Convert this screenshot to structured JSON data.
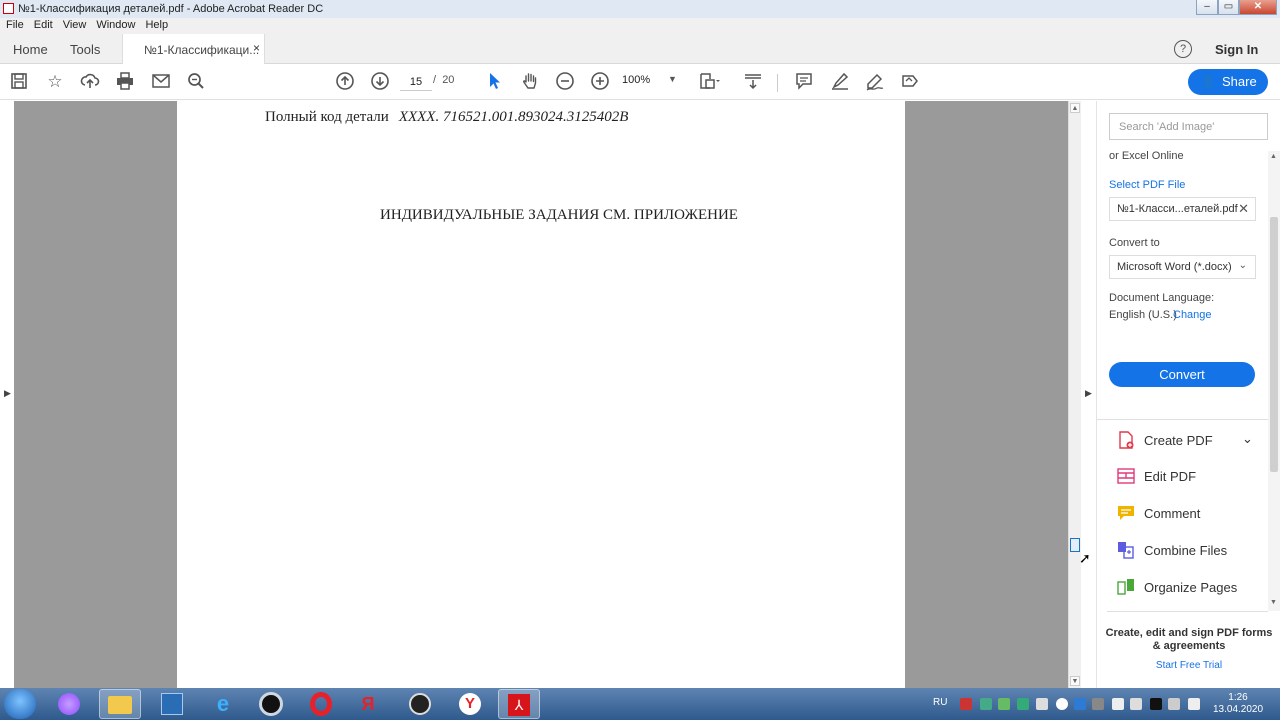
{
  "window": {
    "title": "№1-Классификация деталей.pdf - Adobe Acrobat Reader DC",
    "buttons": {
      "minimize": "–",
      "maximize": "▭",
      "close": "✕"
    }
  },
  "menu": [
    "File",
    "Edit",
    "View",
    "Window",
    "Help"
  ],
  "tabs": {
    "home": "Home",
    "tools": "Tools",
    "document": "№1-Классификаци...",
    "close": "×",
    "help": "?",
    "sign_in": "Sign In"
  },
  "toolbar": {
    "page_current": "15",
    "page_separator": "/",
    "page_total": "20",
    "zoom": "100%",
    "share_label": "Share",
    "icons": [
      "save-icon",
      "bookmark-icon",
      "upload-icon",
      "print-icon",
      "email-icon",
      "search-icon",
      "page-up-icon",
      "page-down-icon",
      "zoom-out-icon",
      "zoom-in-icon",
      "select-icon",
      "hand-icon",
      "fit-page-icon",
      "scroll-mode-icon",
      "comment-icon",
      "highlight-icon",
      "sign-icon",
      "fill-icon"
    ]
  },
  "document": {
    "code_label": "Полный код детали",
    "code_value": "XXXX. 716521.001.893024.3125402B",
    "heading": "ИНДИВИДУАЛЬНЫЕ ЗАДАНИЯ СМ. ПРИЛОЖЕНИЕ"
  },
  "right_pane": {
    "search_placeholder": "Search 'Add Image'",
    "excel_online": "or Excel Online",
    "select_pdf_label": "Select PDF File",
    "selected_file": "№1-Класси...еталей.pdf",
    "convert_to_label": "Convert to",
    "convert_to_value": "Microsoft Word (*.docx)",
    "doc_language_label": "Document Language:",
    "doc_language_value": "English (U.S.)",
    "change_link": "Change",
    "convert_button": "Convert",
    "tools": [
      {
        "label": "Create PDF",
        "icon": "create-pdf-icon",
        "color": "#e0394a"
      },
      {
        "label": "Edit PDF",
        "icon": "edit-pdf-icon",
        "color": "#e0397a"
      },
      {
        "label": "Comment",
        "icon": "comment-icon",
        "color": "#f0b400"
      },
      {
        "label": "Combine Files",
        "icon": "combine-files-icon",
        "color": "#5c5ce0"
      },
      {
        "label": "Organize Pages",
        "icon": "organize-pages-icon",
        "color": "#4aa83a"
      }
    ],
    "promo": "Create, edit and sign PDF forms & agreements",
    "trial_link": "Start Free Trial"
  },
  "taskbar": {
    "apps": [
      "start",
      "alice",
      "explorer",
      "files",
      "ie",
      "media",
      "opera",
      "yandex",
      "obs",
      "yandex-browser",
      "acrobat"
    ],
    "language": "RU",
    "time": "1:26",
    "date": "13.04.2020"
  }
}
